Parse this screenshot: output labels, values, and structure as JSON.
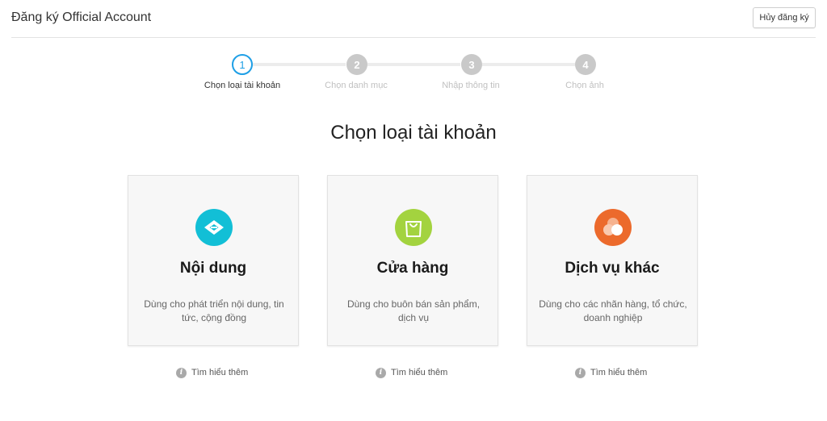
{
  "header": {
    "title": "Đăng ký Official Account",
    "cancel_label": "Hủy đăng ký"
  },
  "stepper": {
    "current_step": 1,
    "steps": [
      {
        "number": "1",
        "label": "Chọn loại tài khoản"
      },
      {
        "number": "2",
        "label": "Chọn danh mục"
      },
      {
        "number": "3",
        "label": "Nhập thông tin"
      },
      {
        "number": "4",
        "label": "Chọn ảnh"
      }
    ]
  },
  "main": {
    "heading": "Chọn loại tài khoản"
  },
  "cards": [
    {
      "title": "Nội dung",
      "description": "Dùng cho phát triển nội dung, tin tức, cộng đồng",
      "icon": "content-icon",
      "color": "#12bfd6",
      "learn_more": "Tìm hiểu thêm"
    },
    {
      "title": "Cửa hàng",
      "description": "Dùng cho buôn bán sản phẩm, dịch vụ",
      "icon": "shopping-bag-icon",
      "color": "#a3d33f",
      "learn_more": "Tìm hiểu thêm"
    },
    {
      "title": "Dịch vụ khác",
      "description": "Dùng cho các nhãn hàng, tổ chức, doanh nghiệp",
      "icon": "circles-icon",
      "color": "#ec6a2c",
      "learn_more": "Tìm hiểu thêm"
    }
  ],
  "colors": {
    "accent": "#1e9fe6",
    "inactive_step": "#c9c9c9"
  }
}
